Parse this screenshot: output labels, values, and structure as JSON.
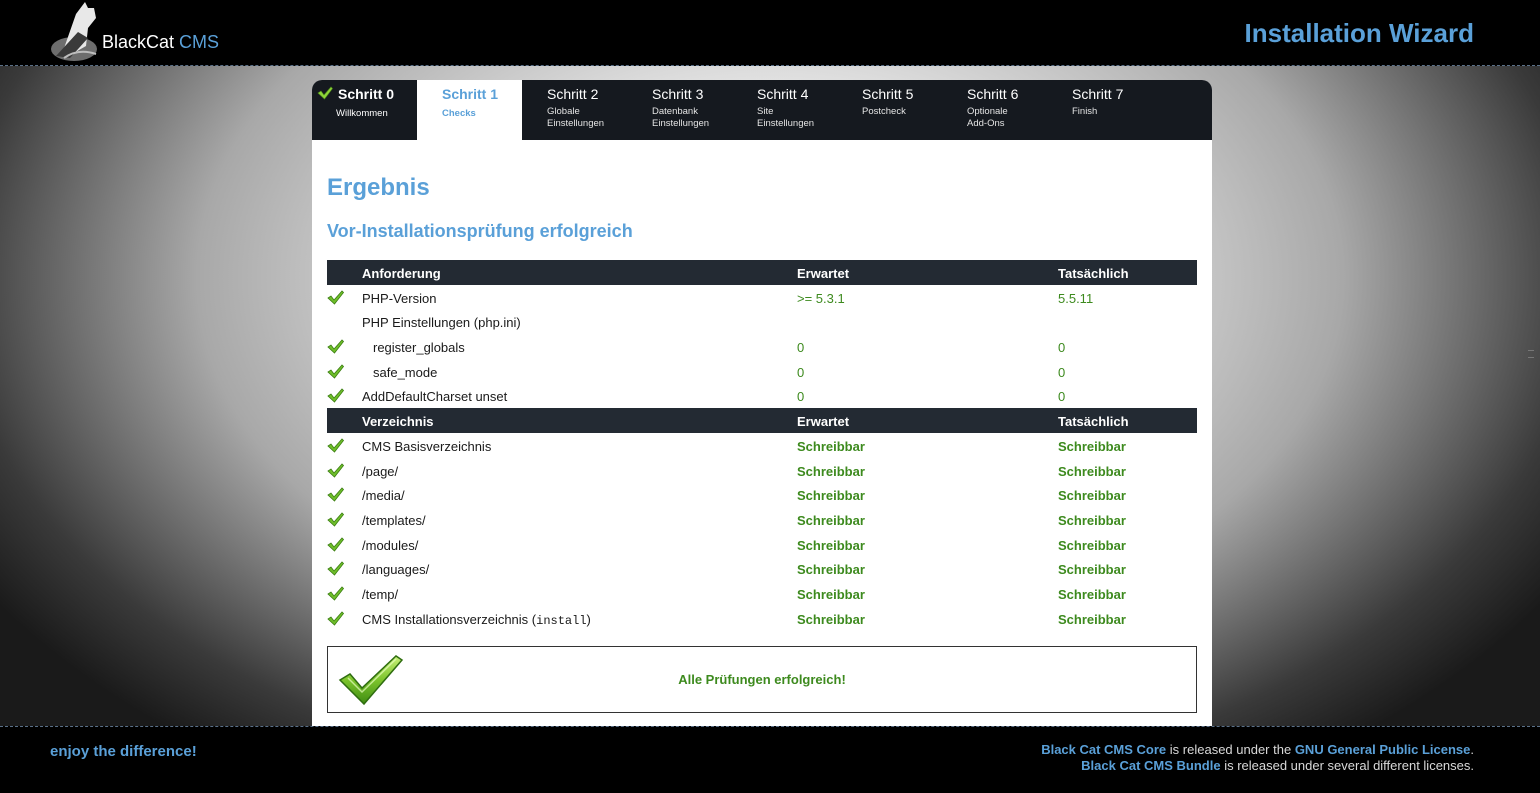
{
  "header": {
    "logo_brand": "BlackCat",
    "logo_cms": "CMS",
    "wizard_title": "Installation Wizard"
  },
  "tabs": [
    {
      "title": "Schritt 0",
      "sub1": "Willkommen",
      "sub2": "",
      "state": "done"
    },
    {
      "title": "Schritt 1",
      "sub1": "Checks",
      "sub2": "",
      "state": "active"
    },
    {
      "title": "Schritt 2",
      "sub1": "Globale",
      "sub2": "Einstellungen",
      "state": "pending"
    },
    {
      "title": "Schritt 3",
      "sub1": "Datenbank",
      "sub2": "Einstellungen",
      "state": "pending"
    },
    {
      "title": "Schritt 4",
      "sub1": "Site",
      "sub2": "Einstellungen",
      "state": "pending"
    },
    {
      "title": "Schritt 5",
      "sub1": "Postcheck",
      "sub2": "",
      "state": "pending"
    },
    {
      "title": "Schritt 6",
      "sub1": "Optionale",
      "sub2": "Add-Ons",
      "state": "pending"
    },
    {
      "title": "Schritt 7",
      "sub1": "Finish",
      "sub2": "",
      "state": "pending"
    }
  ],
  "main": {
    "heading": "Ergebnis",
    "subheading": "Vor-Installationsprüfung erfolgreich"
  },
  "requirements": {
    "headers": {
      "name": "Anforderung",
      "expected": "Erwartet",
      "actual": "Tatsächlich"
    },
    "rows": [
      {
        "name": "PHP-Version",
        "expected": ">= 5.3.1",
        "actual": "5.5.11",
        "ok": true
      },
      {
        "name": "PHP Einstellungen (php.ini)",
        "expected": "",
        "actual": "",
        "ok": false
      },
      {
        "name": "register_globals",
        "expected": "0",
        "actual": "0",
        "ok": true
      },
      {
        "name": "safe_mode",
        "expected": "0",
        "actual": "0",
        "ok": true
      },
      {
        "name": "AddDefaultCharset unset",
        "expected": "0",
        "actual": "0",
        "ok": true
      }
    ]
  },
  "directories": {
    "headers": {
      "name": "Verzeichnis",
      "expected": "Erwartet",
      "actual": "Tatsächlich"
    },
    "rows": [
      {
        "name": "CMS Basisverzeichnis",
        "expected": "Schreibbar",
        "actual": "Schreibbar"
      },
      {
        "name": "/page/",
        "expected": "Schreibbar",
        "actual": "Schreibbar"
      },
      {
        "name": "/media/",
        "expected": "Schreibbar",
        "actual": "Schreibbar"
      },
      {
        "name": "/templates/",
        "expected": "Schreibbar",
        "actual": "Schreibbar"
      },
      {
        "name": "/modules/",
        "expected": "Schreibbar",
        "actual": "Schreibbar"
      },
      {
        "name": "/languages/",
        "expected": "Schreibbar",
        "actual": "Schreibbar"
      },
      {
        "name": "/temp/",
        "expected": "Schreibbar",
        "actual": "Schreibbar"
      },
      {
        "name_prefix": "CMS Installationsverzeichnis (",
        "name_code": "install",
        "name_suffix": ")",
        "expected": "Schreibbar",
        "actual": "Schreibbar"
      }
    ]
  },
  "result": {
    "message": "Alle Prüfungen erfolgreich!"
  },
  "footer": {
    "tagline": "enjoy the difference!",
    "line1_link": "Black Cat CMS Core",
    "line1_text": " is released under the ",
    "line1_link2": "GNU General Public License",
    "line1_end": ".",
    "line2_link": "Black Cat CMS Bundle",
    "line2_text": " is released under several different licenses."
  },
  "colors": {
    "accent": "#5aa0d8",
    "success": "#3d8a1e",
    "dark": "#232a33"
  }
}
